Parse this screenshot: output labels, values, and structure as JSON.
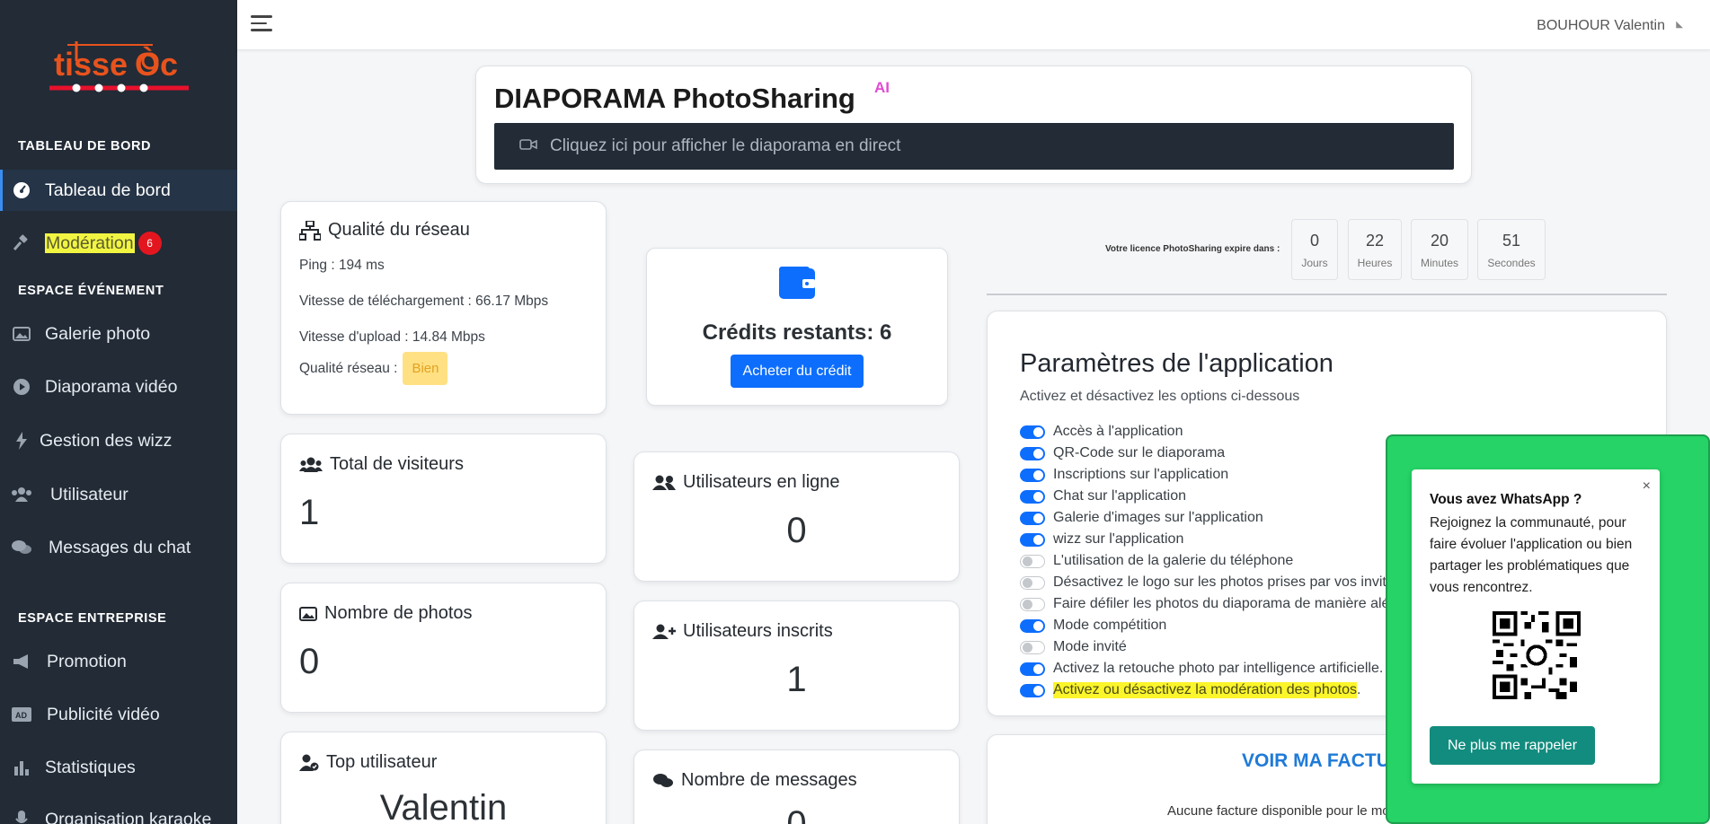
{
  "app": {
    "logo_text": "tisseÒc"
  },
  "topbar": {
    "user_name": "BOUHOUR Valentin"
  },
  "sidebar": {
    "sections": [
      {
        "title": "TABLEAU DE BORD"
      },
      {
        "title": "ESPACE ÉVÉNEMENT"
      },
      {
        "title": "ESPACE ENTREPRISE"
      }
    ],
    "items": [
      {
        "label": "Tableau de bord",
        "icon": "dashboard-icon",
        "active": true
      },
      {
        "label": "Modération",
        "icon": "gavel-icon",
        "badge": "6"
      },
      {
        "label": "Galerie photo",
        "icon": "image-icon"
      },
      {
        "label": "Diaporama vidéo",
        "icon": "play-circle-icon"
      },
      {
        "label": "Gestion des wizz",
        "icon": "bolt-icon"
      },
      {
        "label": "Utilisateur",
        "icon": "users-icon"
      },
      {
        "label": "Messages du chat",
        "icon": "chat-icon"
      },
      {
        "label": "Promotion",
        "icon": "megaphone-icon"
      },
      {
        "label": "Publicité vidéo",
        "icon": "ad-icon"
      },
      {
        "label": "Statistiques",
        "icon": "bar-chart-icon"
      },
      {
        "label": "Organisation karaoke",
        "icon": "microphone-icon"
      }
    ]
  },
  "diaporama": {
    "title": "DIAPORAMA PhotoSharing",
    "ai_mark": "AI",
    "live_link": "Cliquez ici pour afficher le diaporama en direct"
  },
  "network": {
    "title": "Qualité du réseau",
    "ping": "Ping : 194 ms",
    "download": "Vitesse de téléchargement : 66.17 Mbps",
    "upload": "Vitesse d'upload : 14.84 Mbps",
    "quality_label": "Qualité réseau :",
    "quality_value": "Bien"
  },
  "credits": {
    "label": "Crédits restants: 6",
    "buy_button": "Acheter du crédit"
  },
  "stats": {
    "visitors": {
      "title": "Total de visiteurs",
      "value": "1"
    },
    "photos": {
      "title": "Nombre de photos",
      "value": "0"
    },
    "top_user": {
      "title": "Top utilisateur",
      "value": "Valentin"
    },
    "online": {
      "title": "Utilisateurs en ligne",
      "value": "0"
    },
    "registered": {
      "title": "Utilisateurs inscrits",
      "value": "1"
    },
    "messages": {
      "title": "Nombre de messages",
      "value": "0"
    }
  },
  "license": {
    "label": "Votre licence PhotoSharing expire dans :",
    "countdown": [
      {
        "value": "0",
        "unit": "Jours"
      },
      {
        "value": "22",
        "unit": "Heures"
      },
      {
        "value": "20",
        "unit": "Minutes"
      },
      {
        "value": "51",
        "unit": "Secondes"
      }
    ]
  },
  "settings": {
    "title": "Paramètres de l'application",
    "subtitle": "Activez et désactivez les options ci-dessous",
    "options": [
      {
        "label": "Accès à l'application",
        "enabled": true
      },
      {
        "label": "QR-Code sur le diaporama",
        "enabled": true
      },
      {
        "label": "Inscriptions sur l'application",
        "enabled": true
      },
      {
        "label": "Chat sur l'application",
        "enabled": true
      },
      {
        "label": "Galerie d'images sur l'application",
        "enabled": true
      },
      {
        "label": "wizz sur l'application",
        "enabled": true
      },
      {
        "label": "L'utilisation de la galerie du téléphone",
        "enabled": false
      },
      {
        "label": "Désactivez le logo sur les photos prises par vos invités",
        "enabled": false
      },
      {
        "label": "Faire défiler les photos du diaporama de manière aléatoire",
        "enabled": false
      },
      {
        "label": "Mode compétition",
        "enabled": true
      },
      {
        "label": "Mode invité",
        "enabled": false
      },
      {
        "label": "Activez la retouche photo par intelligence artificielle.",
        "enabled": true
      },
      {
        "label": "Activez ou désactivez la modération des photos",
        "enabled": true,
        "highlight": true
      }
    ],
    "last_suffix": "."
  },
  "invoice": {
    "title": "VOIR MA FACTURE",
    "empty": "Aucune facture disponible pour le moment"
  },
  "whatsapp": {
    "title": "Vous avez WhatsApp ?",
    "text": "Rejoignez la communauté, pour faire évoluer l'application ou bien partager les problématiques que vous rencontrez.",
    "close": "×",
    "button": "Ne plus me rappeler"
  },
  "colors": {
    "sidebar_bg": "#222b36",
    "primary": "#0d6efd",
    "whatsapp_green": "#25d366",
    "whatsapp_teal": "#128c7e",
    "badge_red": "#e3161f",
    "highlight_yellow": "#fbf52b"
  }
}
